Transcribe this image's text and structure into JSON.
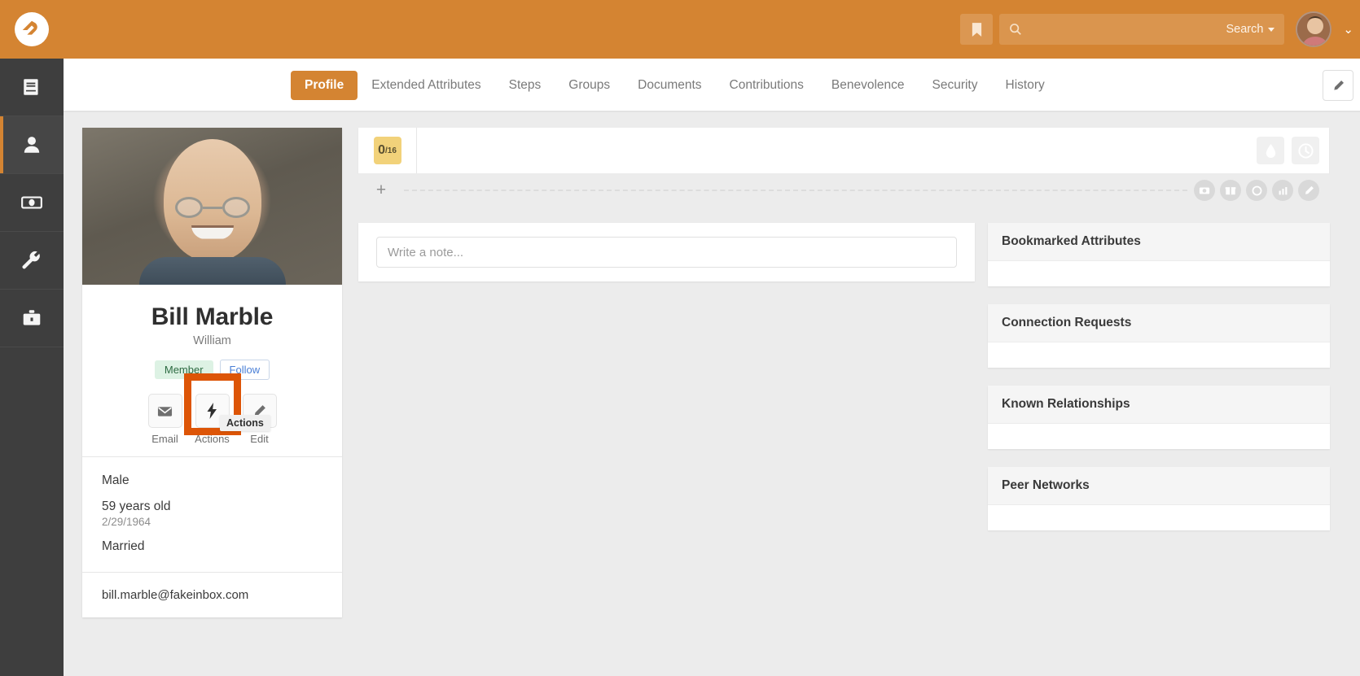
{
  "topbar": {
    "logo_name": "rock-rms-logo",
    "bookmark_icon": "bookmark-icon",
    "search_icon": "search-icon",
    "search_value": "",
    "search_placeholder": "",
    "search_label": "Search",
    "avatar_name": "user-avatar",
    "accent_color": "#d48432"
  },
  "sidebar": {
    "items": [
      {
        "name": "sidebar-item-cms",
        "icon": "book-icon",
        "active": false
      },
      {
        "name": "sidebar-item-people",
        "icon": "person-icon",
        "active": true
      },
      {
        "name": "sidebar-item-finance",
        "icon": "money-icon",
        "active": false
      },
      {
        "name": "sidebar-item-tools",
        "icon": "wrench-icon",
        "active": false
      },
      {
        "name": "sidebar-item-admin",
        "icon": "briefcase-icon",
        "active": false
      }
    ]
  },
  "nav": {
    "tabs": [
      {
        "label": "Profile",
        "active": true
      },
      {
        "label": "Extended Attributes",
        "active": false
      },
      {
        "label": "Steps",
        "active": false
      },
      {
        "label": "Groups",
        "active": false
      },
      {
        "label": "Documents",
        "active": false
      },
      {
        "label": "Contributions",
        "active": false
      },
      {
        "label": "Benevolence",
        "active": false
      },
      {
        "label": "Security",
        "active": false
      },
      {
        "label": "History",
        "active": false
      }
    ],
    "edit_icon": "pencil-icon"
  },
  "person": {
    "photo_alt": "person-photo",
    "name": "Bill Marble",
    "nickname": "William",
    "member_tag": "Member",
    "follow_label": "Follow",
    "actions": [
      {
        "label": "Email",
        "icon": "envelope-icon"
      },
      {
        "label": "Actions",
        "icon": "bolt-icon"
      },
      {
        "label": "Edit",
        "icon": "pencil-icon"
      }
    ],
    "tooltip": "Actions",
    "gender": "Male",
    "age": "59 years old",
    "birthdate": "2/29/1964",
    "marital_status": "Married",
    "email": "bill.marble@fakeinbox.com"
  },
  "badge_bar": {
    "count_value": "0",
    "count_total": "/16",
    "right_icons": [
      {
        "name": "baptism-drop-icon"
      },
      {
        "name": "clock-history-icon"
      }
    ],
    "add_label": "+",
    "small_icons": [
      {
        "name": "camera-icon"
      },
      {
        "name": "gift-icon"
      },
      {
        "name": "circle-icon"
      },
      {
        "name": "chart-icon"
      },
      {
        "name": "pencil-icon"
      }
    ]
  },
  "note": {
    "placeholder": "Write a note...",
    "value": ""
  },
  "right_panels": [
    {
      "title": "Bookmarked Attributes"
    },
    {
      "title": "Connection Requests"
    },
    {
      "title": "Known Relationships"
    },
    {
      "title": "Peer Networks"
    }
  ],
  "highlight": {
    "color": "#dd5507"
  }
}
